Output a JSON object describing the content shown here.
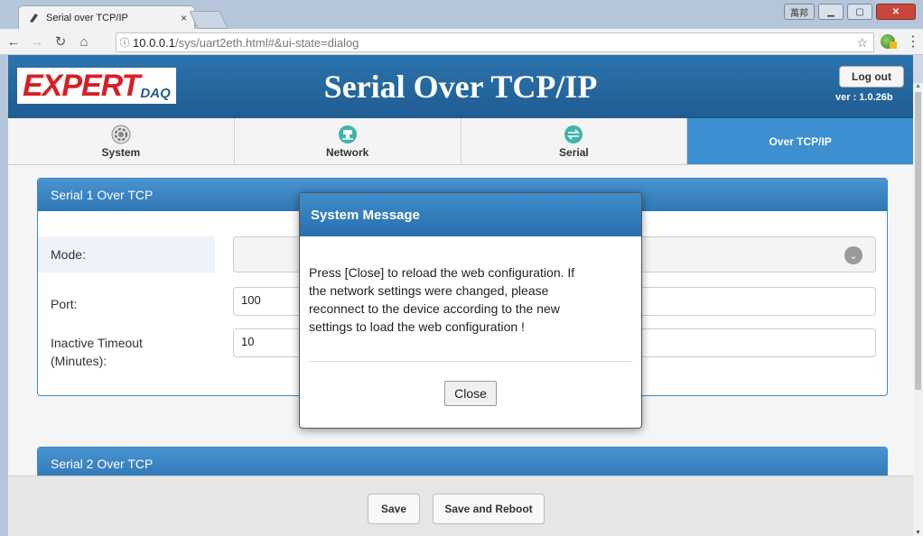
{
  "browser": {
    "tab_title": "Serial over TCP/IP",
    "tab_close": "×",
    "ime_label": "萬邦",
    "url_host": "10.0.0.1",
    "url_path": "/sys/uart2eth.html#&ui-state=dialog"
  },
  "header": {
    "logo_main": "EXPERT",
    "logo_sub": "DAQ",
    "title": "Serial Over TCP/IP",
    "logout_label": "Log out",
    "version": "ver : 1.0.26b"
  },
  "nav": {
    "tabs": [
      {
        "label": "System",
        "icon": "gear-icon",
        "active": false
      },
      {
        "label": "Network",
        "icon": "network-icon",
        "active": false
      },
      {
        "label": "Serial",
        "icon": "serial-icon",
        "active": false
      },
      {
        "label": "Over TCP/IP",
        "icon": "",
        "active": true
      }
    ]
  },
  "panel1": {
    "title": "Serial 1 Over TCP",
    "mode_label": "Mode:",
    "port_label": "Port:",
    "port_value": "100",
    "timeout_label_line1": "Inactive Timeout",
    "timeout_label_line2": "(Minutes):",
    "timeout_value": "10"
  },
  "panel2": {
    "title": "Serial 2 Over TCP"
  },
  "footer": {
    "save_label": "Save",
    "save_reboot_label": "Save and Reboot"
  },
  "dialog": {
    "title": "System Message",
    "message_line1": "Press [Close] to reload the web configuration. If",
    "message_line2": "the network settings were changed, please",
    "message_line3": "reconnect to the device according to the new",
    "message_line4": "settings to load the web configuration !",
    "close_label": "Close"
  },
  "colors": {
    "header_blue": "#1f5c92",
    "active_tab": "#3d8fd0",
    "logo_red": "#d71f26"
  }
}
